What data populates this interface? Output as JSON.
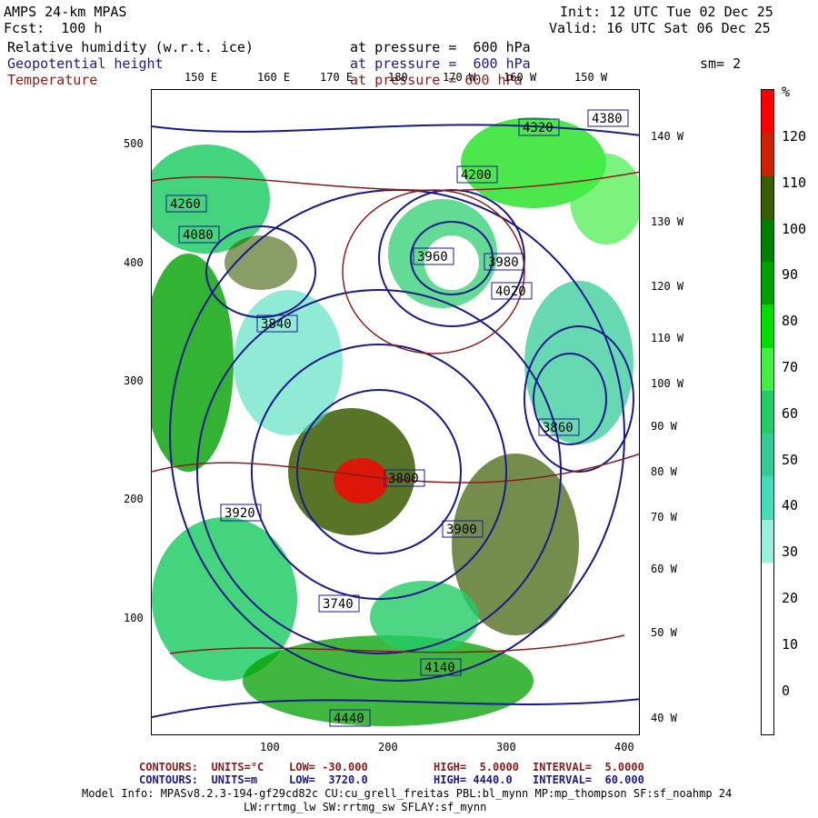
{
  "header": {
    "model": "AMPS 24-km MPAS",
    "fcst": "Fcst:  100 h",
    "init": "Init: 12 UTC Tue 02 Dec 25",
    "valid": "Valid: 16 UTC Sat 06 Dec 25",
    "field1": "Relative humidity (w.r.t. ice)",
    "field1_level": "at pressure =  600 hPa",
    "field2": "Geopotential height",
    "field2_level": "at pressure =  600 hPa",
    "field3": "Temperature",
    "field3_level": "at pressure = 600 hPa",
    "smooth": "sm= 2"
  },
  "axes": {
    "left_ticks": [
      "500",
      "400",
      "300",
      "200",
      "100"
    ],
    "bottom_ticks": [
      "100",
      "200",
      "300",
      "400"
    ],
    "top_lon": [
      "150 E",
      "160 E",
      "170 E",
      "180",
      "170 W",
      "160 W",
      "150 W"
    ],
    "right_lon": [
      "140 W",
      "130 W",
      "120 W",
      "110 W",
      "100 W",
      "90 W",
      "80 W",
      "70 W",
      "60 W",
      "50 W",
      "40 W"
    ]
  },
  "colorbar": {
    "unit": "%",
    "labels": [
      "120",
      "110",
      "100",
      "90",
      "80",
      "70",
      "60",
      "50",
      "40",
      "30",
      "20",
      "10",
      "0"
    ],
    "colors": [
      "#ff0000",
      "#cc2200",
      "#3b5c00",
      "#007f00",
      "#00a000",
      "#00dd00",
      "#44ee44",
      "#22cc66",
      "#33cc99",
      "#44ddbb",
      "#99f0dd",
      "#ffffff",
      "#ffffff",
      "#ffffff",
      "#ffffff"
    ]
  },
  "height_labels": [
    "4380",
    "4320",
    "4200",
    "4260",
    "4080",
    "3960",
    "3980",
    "4020",
    "3840",
    "3900",
    "3740",
    "4140",
    "3800",
    "3860",
    "3920",
    "4440"
  ],
  "footer": {
    "contours1_label": "CONTOURS:  UNITS=°C",
    "contours1_low": "LOW= -30.000",
    "contours1_high": "HIGH=  5.0000",
    "contours1_interval": "INTERVAL=  5.0000",
    "contours2_label": "CONTOURS:  UNITS=m",
    "contours2_low": "LOW=  3720.0",
    "contours2_high": "HIGH= 4440.0",
    "contours2_interval": "INTERVAL=  60.000",
    "model_info": "Model Info: MPASv8.2.3-194-gf29cd82c CU:cu_grell_freitas PBL:bl_mynn MP:mp_thompson SF:sf_noahmp 24",
    "model_info2": "LW:rrtmg_lw SW:rrtmg_sw SFLAY:sf_mynn"
  }
}
